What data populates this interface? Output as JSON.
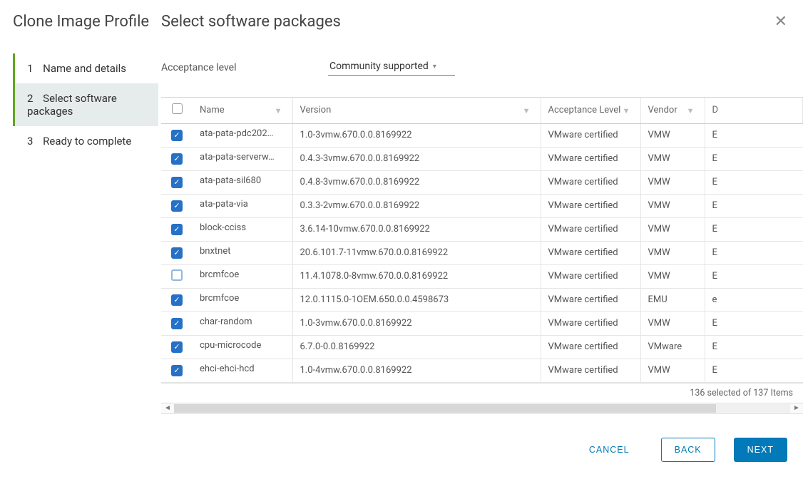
{
  "sidebar": {
    "title": "Clone Image Profile",
    "steps": [
      {
        "num": "1",
        "label": "Name and details",
        "active": false
      },
      {
        "num": "2",
        "label": "Select software packages",
        "active": true
      },
      {
        "num": "3",
        "label": "Ready to complete",
        "active": false
      }
    ]
  },
  "main": {
    "title": "Select software packages",
    "acceptance_label": "Acceptance level",
    "acceptance_value": "Community supported"
  },
  "table": {
    "headers": {
      "name": "Name",
      "version": "Version",
      "acceptance": "Acceptance Level",
      "vendor": "Vendor",
      "last": "D"
    },
    "rows": [
      {
        "checked": true,
        "name": "ata-pata-pdc202…",
        "version": "1.0-3vmw.670.0.0.8169922",
        "acceptance": "VMware certified",
        "vendor": "VMW",
        "d": "E"
      },
      {
        "checked": true,
        "name": "ata-pata-serverw…",
        "version": "0.4.3-3vmw.670.0.0.8169922",
        "acceptance": "VMware certified",
        "vendor": "VMW",
        "d": "E"
      },
      {
        "checked": true,
        "name": "ata-pata-sil680",
        "version": "0.4.8-3vmw.670.0.0.8169922",
        "acceptance": "VMware certified",
        "vendor": "VMW",
        "d": "E"
      },
      {
        "checked": true,
        "name": "ata-pata-via",
        "version": "0.3.3-2vmw.670.0.0.8169922",
        "acceptance": "VMware certified",
        "vendor": "VMW",
        "d": "E"
      },
      {
        "checked": true,
        "name": "block-cciss",
        "version": "3.6.14-10vmw.670.0.0.8169922",
        "acceptance": "VMware certified",
        "vendor": "VMW",
        "d": "E"
      },
      {
        "checked": true,
        "name": "bnxtnet",
        "version": "20.6.101.7-11vmw.670.0.0.8169922",
        "acceptance": "VMware certified",
        "vendor": "VMW",
        "d": "E"
      },
      {
        "checked": false,
        "name": "brcmfcoe",
        "version": "11.4.1078.0-8vmw.670.0.0.8169922",
        "acceptance": "VMware certified",
        "vendor": "VMW",
        "d": "E"
      },
      {
        "checked": true,
        "name": "brcmfcoe",
        "version": "12.0.1115.0-1OEM.650.0.0.4598673",
        "acceptance": "VMware certified",
        "vendor": "EMU",
        "d": "e"
      },
      {
        "checked": true,
        "name": "char-random",
        "version": "1.0-3vmw.670.0.0.8169922",
        "acceptance": "VMware certified",
        "vendor": "VMW",
        "d": "E"
      },
      {
        "checked": true,
        "name": "cpu-microcode",
        "version": "6.7.0-0.0.8169922",
        "acceptance": "VMware certified",
        "vendor": "VMware",
        "d": "E"
      },
      {
        "checked": true,
        "name": "ehci-ehci-hcd",
        "version": "1.0-4vmw.670.0.0.8169922",
        "acceptance": "VMware certified",
        "vendor": "VMW",
        "d": "E"
      }
    ],
    "status": "136 selected of 137 Items"
  },
  "footer": {
    "cancel": "CANCEL",
    "back": "BACK",
    "next": "NEXT"
  }
}
